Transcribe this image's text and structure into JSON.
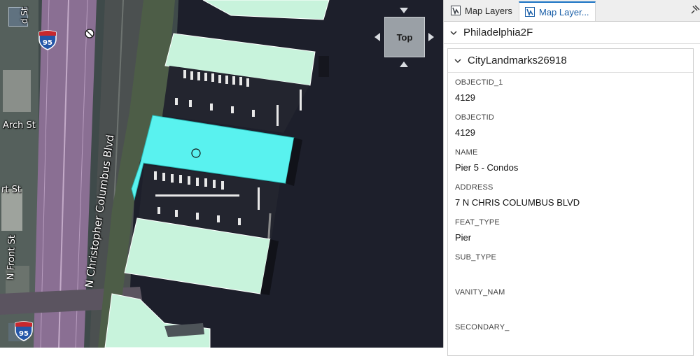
{
  "map": {
    "labels": {
      "arch_st": "Arch St",
      "rt_st": "rt St",
      "n_christopher_columbus_blvd": "N Christopher Columbus Blvd",
      "n_front_st": "N Front St",
      "top_st": "d St"
    },
    "shields": {
      "interstate_a": "95",
      "interstate_b": "95"
    },
    "nav_cube": {
      "face_label": "Top"
    }
  },
  "panel": {
    "tabs": [
      {
        "label": "Map Layers",
        "active": false
      },
      {
        "label": "Map Layer...",
        "active": true
      }
    ],
    "group": {
      "title": "Philadelphia2F"
    },
    "layer": {
      "title": "CityLandmarks26918",
      "attributes": [
        {
          "name": "OBJECTID_1",
          "value": "4129"
        },
        {
          "name": "OBJECTID",
          "value": "4129"
        },
        {
          "name": "NAME",
          "value": "Pier 5 - Condos"
        },
        {
          "name": "ADDRESS",
          "value": "7 N CHRIS COLUMBUS BLVD"
        },
        {
          "name": "FEAT_TYPE",
          "value": "Pier"
        },
        {
          "name": "SUB_TYPE",
          "value": ""
        },
        {
          "name": "VANITY_NAM",
          "value": ""
        },
        {
          "name": "SECONDARY_",
          "value": ""
        }
      ]
    }
  },
  "colors": {
    "selected_feature": "#59f2ef",
    "pier_fill": "#c8f3dc",
    "water": "#1d1f2b",
    "active_tab_accent": "#1a73c4"
  }
}
